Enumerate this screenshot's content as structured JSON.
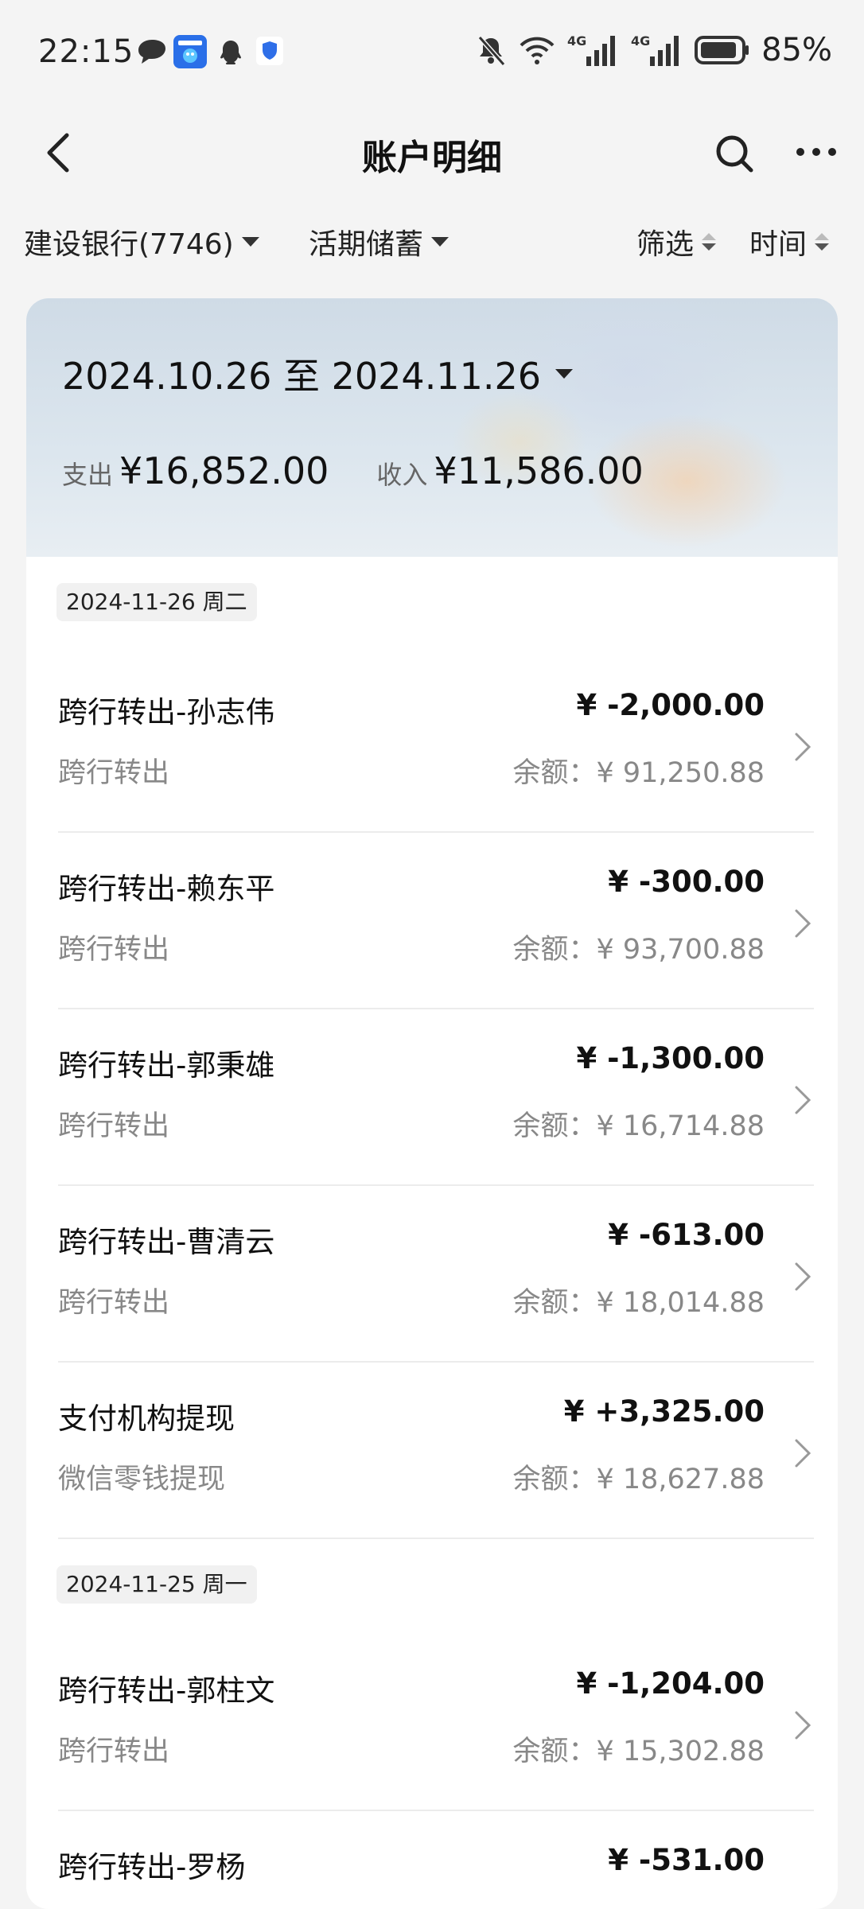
{
  "status": {
    "time": "22:15",
    "battery": "85%",
    "net1": "4G",
    "net2": "4G"
  },
  "header": {
    "title": "账户明细"
  },
  "filters": {
    "account": "建设银行(7746)",
    "type": "活期储蓄",
    "filter": "筛选",
    "time": "时间"
  },
  "summary": {
    "range": "2024.10.26 至 2024.11.26",
    "expense_label": "支出",
    "expense": "¥16,852.00",
    "income_label": "收入",
    "income": "¥11,586.00"
  },
  "groups": [
    {
      "date": "2024-11-26 周二",
      "items": [
        {
          "title": "跨行转出-孙志伟",
          "sub": "跨行转出",
          "amount": "¥ -2,000.00",
          "balance": "余额：¥ 91,250.88"
        },
        {
          "title": "跨行转出-赖东平",
          "sub": "跨行转出",
          "amount": "¥ -300.00",
          "balance": "余额：¥ 93,700.88"
        },
        {
          "title": "跨行转出-郭秉雄",
          "sub": "跨行转出",
          "amount": "¥ -1,300.00",
          "balance": "余额：¥ 16,714.88"
        },
        {
          "title": "跨行转出-曹清云",
          "sub": "跨行转出",
          "amount": "¥ -613.00",
          "balance": "余额：¥ 18,014.88"
        },
        {
          "title": "支付机构提现",
          "sub": "微信零钱提现",
          "amount": "¥ +3,325.00",
          "balance": "余额：¥ 18,627.88"
        }
      ]
    },
    {
      "date": "2024-11-25 周一",
      "items": [
        {
          "title": "跨行转出-郭柱文",
          "sub": "跨行转出",
          "amount": "¥ -1,204.00",
          "balance": "余额：¥ 15,302.88"
        },
        {
          "title": "跨行转出-罗杨",
          "sub": "",
          "amount": "¥ -531.00",
          "balance": ""
        }
      ]
    }
  ],
  "icons": {
    "back": "back-arrow-icon",
    "search": "search-icon",
    "more": "more-icon",
    "chevron": "chevron-right-icon",
    "dropdown": "caret-down-icon"
  },
  "colors": {
    "background": "#f4f4f4",
    "card": "#ffffff",
    "muted": "#888888"
  }
}
